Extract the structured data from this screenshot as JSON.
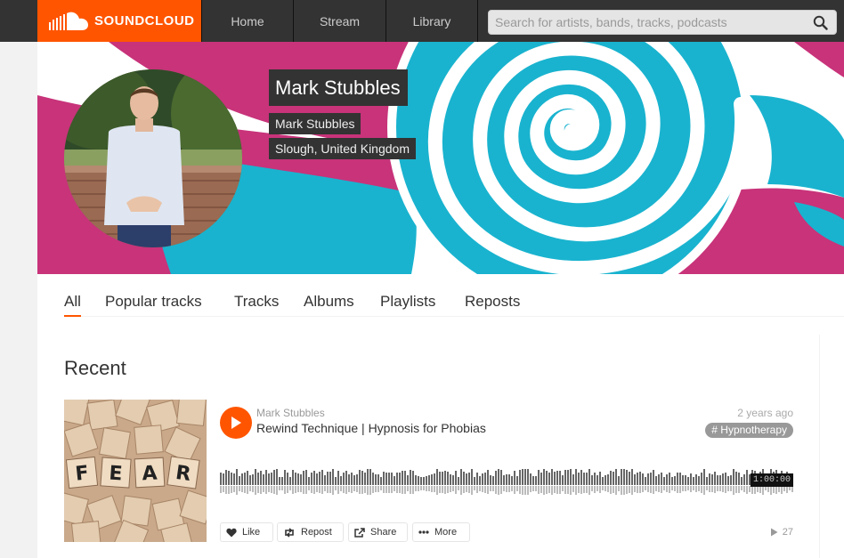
{
  "header": {
    "logo_text": "SOUNDCLOUD",
    "nav": {
      "home": "Home",
      "stream": "Stream",
      "library": "Library"
    },
    "search_placeholder": "Search for artists, bands, tracks, podcasts"
  },
  "profile": {
    "display_name": "Mark Stubbles",
    "username": "Mark Stubbles",
    "location": "Slough, United Kingdom"
  },
  "tabs": [
    "All",
    "Popular tracks",
    "Tracks",
    "Albums",
    "Playlists",
    "Reposts"
  ],
  "active_tab": "All",
  "section_title": "Recent",
  "track": {
    "user": "Mark Stubbles",
    "title": "Rewind Technique | Hypnosis for Phobias",
    "posted": "2 years ago",
    "tag": "# Hypnotherapy",
    "duration": "1:00:00",
    "plays": "27",
    "artwork_text": "FEAR"
  },
  "actions": {
    "like": "Like",
    "repost": "Repost",
    "share": "Share",
    "more": "More"
  },
  "colors": {
    "accent": "#ff5500",
    "header_bg": "#333333",
    "banner_blue": "#19b3cf",
    "banner_pink": "#c8337a"
  }
}
